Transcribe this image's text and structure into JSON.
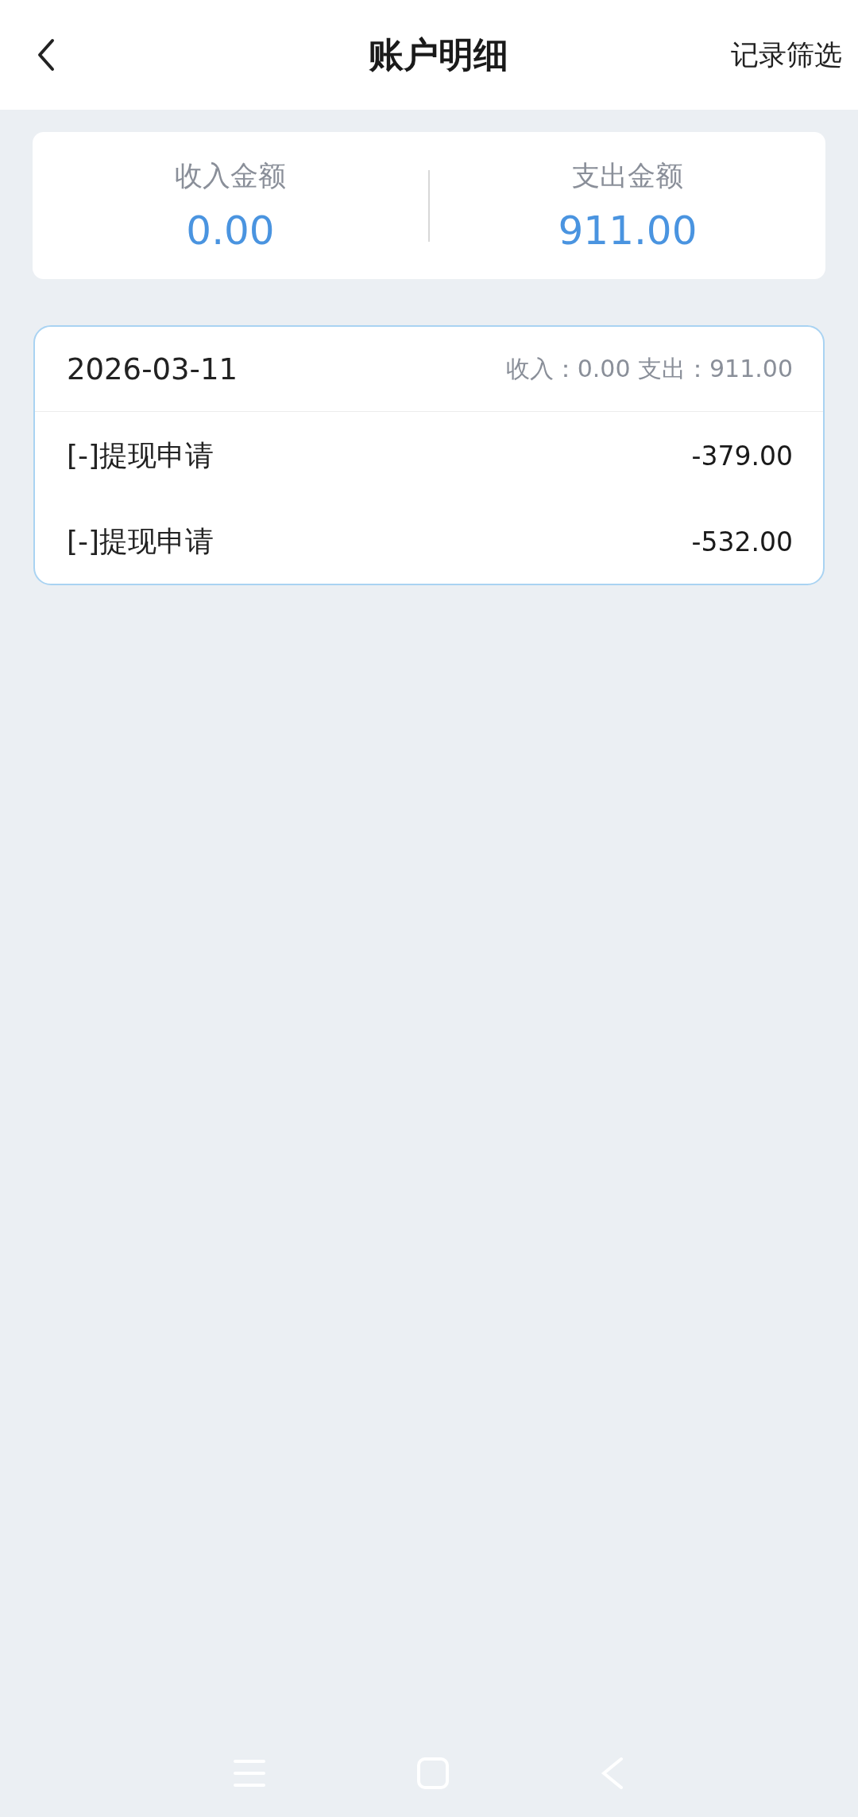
{
  "header": {
    "title": "账户明细",
    "action": "记录筛选"
  },
  "summary": [
    {
      "label": "收入金额",
      "value": "0.00"
    },
    {
      "label": "支出金额",
      "value": "911.00"
    }
  ],
  "groups": [
    {
      "date": "2026-03-11",
      "totals": "收入：0.00 支出：911.00",
      "records": [
        {
          "name": "[-]提现申请",
          "amount": "-379.00"
        },
        {
          "name": "[-]提现申请",
          "amount": "-532.00"
        }
      ]
    }
  ]
}
